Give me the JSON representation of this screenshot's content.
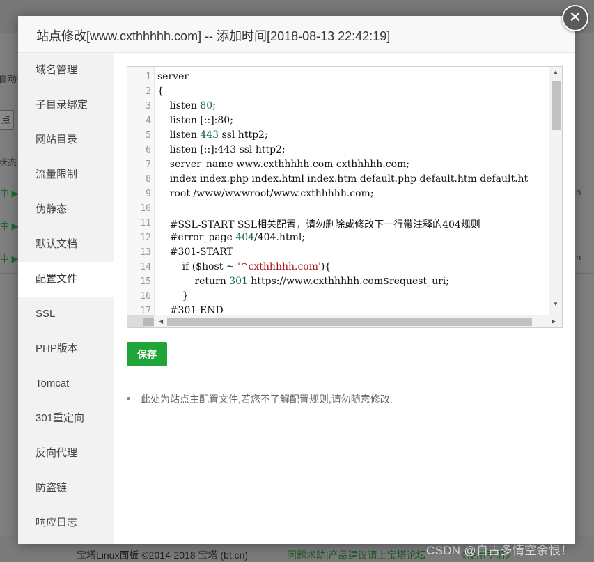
{
  "dialog": {
    "title": "站点修改[www.cxthhhhh.com] -- 添加时间[2018-08-13 22:42:19]",
    "close_icon": "close-icon",
    "sidebar": {
      "items": [
        {
          "label": "域名管理",
          "active": false
        },
        {
          "label": "子目录绑定",
          "active": false
        },
        {
          "label": "网站目录",
          "active": false
        },
        {
          "label": "流量限制",
          "active": false
        },
        {
          "label": "伪静态",
          "active": false
        },
        {
          "label": "默认文档",
          "active": false
        },
        {
          "label": "配置文件",
          "active": true
        },
        {
          "label": "SSL",
          "active": false
        },
        {
          "label": "PHP版本",
          "active": false
        },
        {
          "label": "Tomcat",
          "active": false
        },
        {
          "label": "301重定向",
          "active": false
        },
        {
          "label": "反向代理",
          "active": false
        },
        {
          "label": "防盗链",
          "active": false
        },
        {
          "label": "响应日志",
          "active": false
        }
      ]
    },
    "editor": {
      "lines": [
        {
          "n": "1",
          "text": "server"
        },
        {
          "n": "2",
          "text": "{"
        },
        {
          "n": "3",
          "text": "    listen 80;"
        },
        {
          "n": "4",
          "text": "    listen [::]:80;"
        },
        {
          "n": "5",
          "text": "    listen 443 ssl http2;"
        },
        {
          "n": "6",
          "text": "    listen [::]:443 ssl http2;"
        },
        {
          "n": "7",
          "text": "    server_name www.cxthhhhh.com cxthhhhh.com;"
        },
        {
          "n": "8",
          "text": "    index index.php index.html index.htm default.php default.htm default.ht"
        },
        {
          "n": "9",
          "text": "    root /www/wwwroot/www.cxthhhhh.com;"
        },
        {
          "n": "10",
          "text": ""
        },
        {
          "n": "11",
          "text": "    #SSL-START SSL相关配置，请勿删除或修改下一行带注释的404规则"
        },
        {
          "n": "12",
          "text": "    #error_page 404/404.html;"
        },
        {
          "n": "13",
          "text": "    #301-START"
        },
        {
          "n": "14",
          "text": "        if ($host ~ '^cxthhhhh.com'){"
        },
        {
          "n": "15",
          "text": "            return 301 https://www.cxthhhhh.com$request_uri;"
        },
        {
          "n": "16",
          "text": "        }"
        },
        {
          "n": "17",
          "text": "    #301-END"
        }
      ]
    },
    "save_label": "保存",
    "tip": "此处为站点主配置文件,若您不了解配置规则,请勿随意修改."
  },
  "background": {
    "left_fragments": [
      "自动备",
      "点",
      "状态"
    ],
    "run_rows": [
      "中 ▶",
      "中 ▶",
      "中 ▶"
    ],
    "right_fragments": [
      "n",
      "n"
    ]
  },
  "footer": {
    "copyright": "宝塔Linux面板 ©2014-2018 宝塔 (bt.cn)",
    "links": "问题求助|产品建议请上宝塔论坛",
    "manual": "《使用手册》",
    "watermark": "CSDN @自古多情空余恨！"
  }
}
